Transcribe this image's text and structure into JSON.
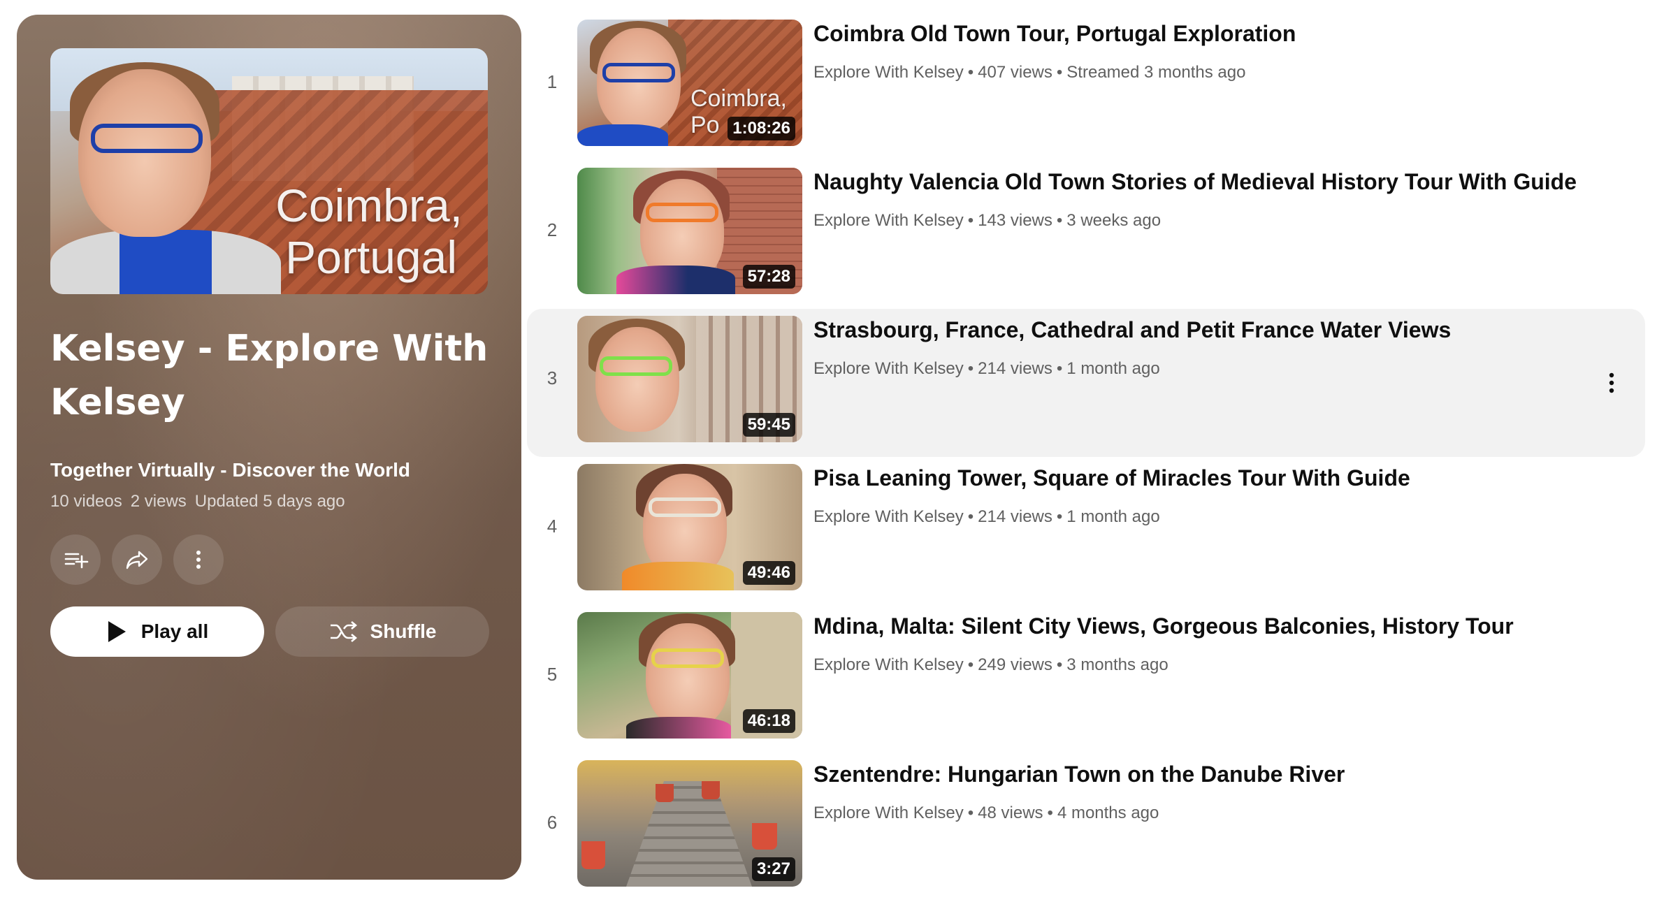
{
  "playlist": {
    "thumbnail_text_line1": "Coimbra,",
    "thumbnail_text_line2": "Portugal",
    "title": "Kelsey - Explore With Kelsey",
    "subtitle": "Together Virtually - Discover the World",
    "video_count": "10 videos",
    "views": "2 views",
    "updated": "Updated 5 days ago",
    "actions": {
      "save_icon": "playlist-add-icon",
      "share_icon": "share-icon",
      "more_icon": "more-vert-icon"
    },
    "play_all_label": "Play all",
    "shuffle_label": "Shuffle",
    "panel_color": "#7c6553"
  },
  "videos": [
    {
      "index": "1",
      "title": "Coimbra Old Town Tour, Portugal Exploration",
      "channel": "Explore With Kelsey",
      "views": "407 views",
      "age": "Streamed 3 months ago",
      "duration": "1:08:26",
      "thumb_overlay_text": "Coimbra, Po",
      "glasses_color": "#1e3fa8"
    },
    {
      "index": "2",
      "title": "Naughty Valencia Old Town Stories of Medieval History Tour With Guide",
      "channel": "Explore With Kelsey",
      "views": "143 views",
      "age": "3 weeks ago",
      "duration": "57:28",
      "glasses_color": "#f07a2a"
    },
    {
      "index": "3",
      "title": "Strasbourg, France, Cathedral and Petit France Water Views",
      "channel": "Explore With Kelsey",
      "views": "214 views",
      "age": "1 month ago",
      "duration": "59:45",
      "glasses_color": "#7fe04a"
    },
    {
      "index": "4",
      "title": "Pisa Leaning Tower, Square of Miracles Tour With Guide",
      "channel": "Explore With Kelsey",
      "views": "214 views",
      "age": "1 month ago",
      "duration": "49:46",
      "glasses_color": "#e9e4d8"
    },
    {
      "index": "5",
      "title": "Mdina, Malta: Silent City Views, Gorgeous Balconies, History Tour",
      "channel": "Explore With Kelsey",
      "views": "249 views",
      "age": "3 months ago",
      "duration": "46:18",
      "glasses_color": "#e6d24a"
    },
    {
      "index": "6",
      "title": "Szentendre: Hungarian Town on the Danube River",
      "channel": "Explore With Kelsey",
      "views": "48 views",
      "age": "4 months ago",
      "duration": "3:27"
    }
  ],
  "hovered_row_more_icon": "more-vert-icon"
}
